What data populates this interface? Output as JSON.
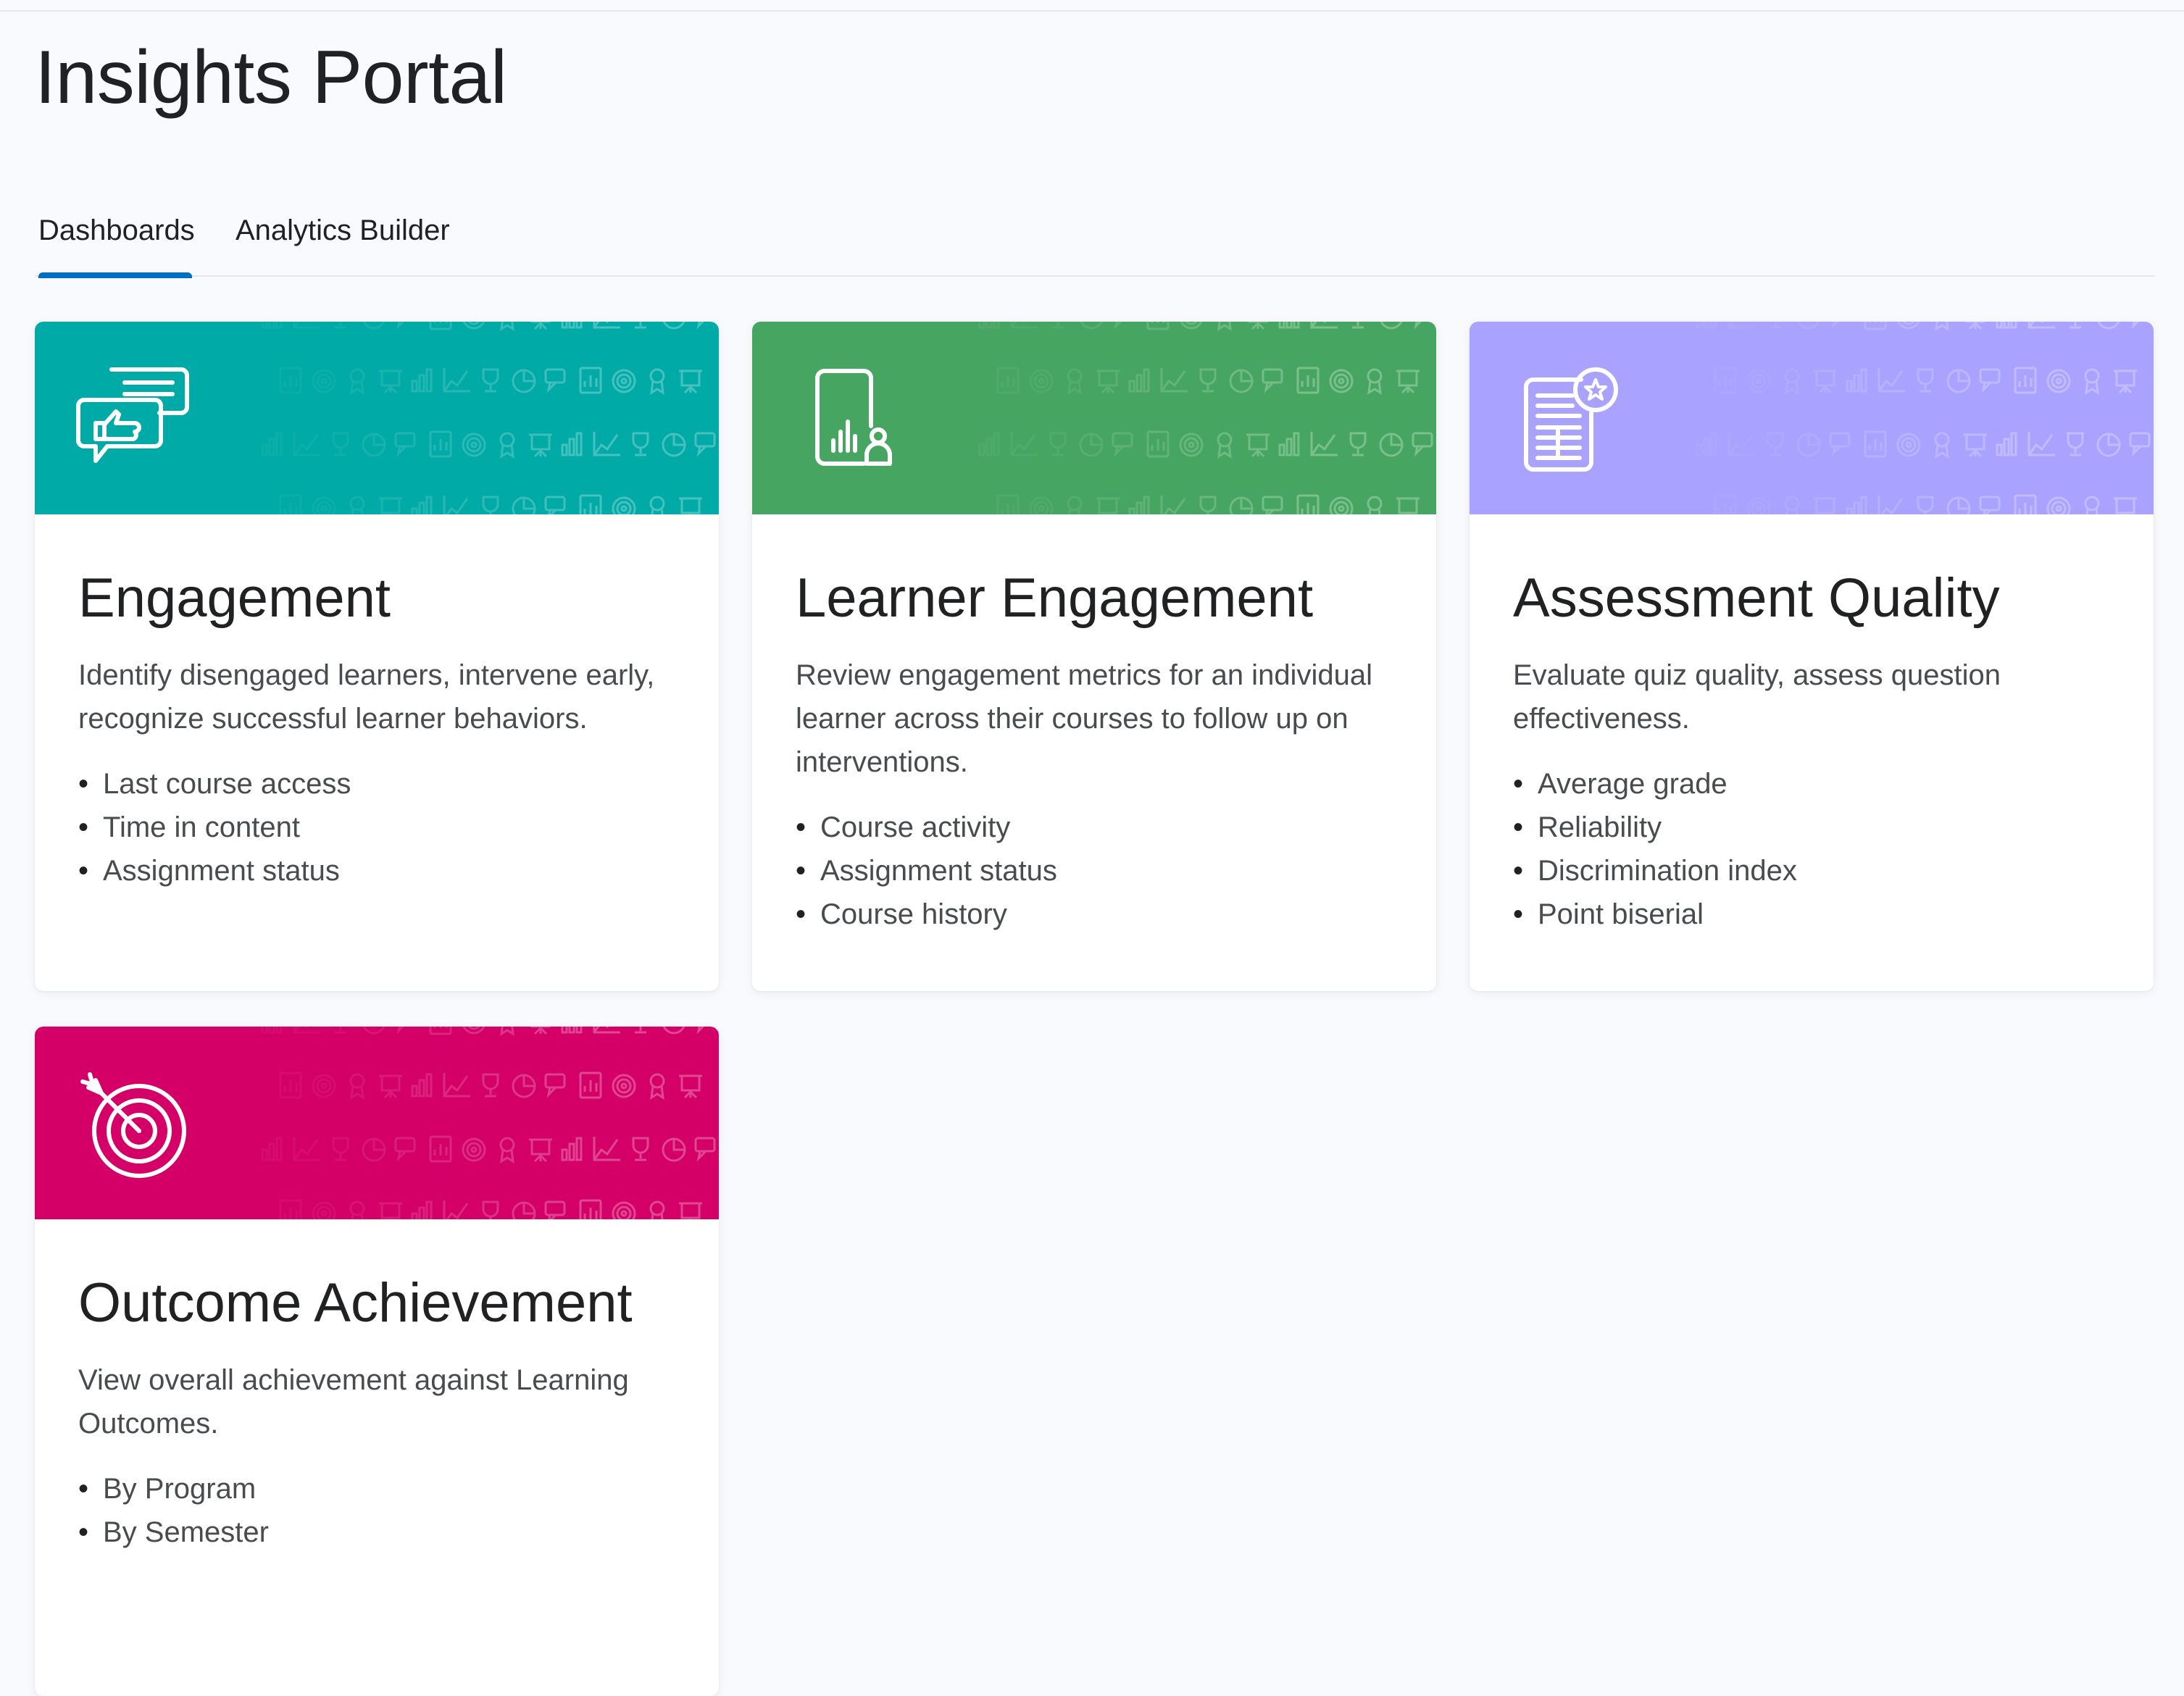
{
  "page": {
    "title": "Insights Portal"
  },
  "tabs": [
    {
      "label": "Dashboards",
      "active": true
    },
    {
      "label": "Analytics Builder",
      "active": false
    }
  ],
  "colors": {
    "tab_underline": "#006fbf",
    "engagement": "#00aaa6",
    "learner_engagement": "#46a661",
    "assessment_quality": "#a9a3ff",
    "outcome_achievement": "#d40067"
  },
  "cards": [
    {
      "title": "Engagement",
      "description": "Identify disengaged learners, intervene early, recognize successful learner behaviors.",
      "icon": "chat-thumbs-up-icon",
      "bullets": [
        "Last course access",
        "Time in content",
        "Assignment status"
      ]
    },
    {
      "title": "Learner Engagement",
      "description": "Review engagement metrics for an individual learner across their courses to follow up on interventions.",
      "icon": "tablet-chart-user-icon",
      "bullets": [
        "Course activity",
        "Assignment status",
        "Course history"
      ]
    },
    {
      "title": "Assessment Quality",
      "description": "Evaluate quiz quality, assess question effectiveness.",
      "icon": "document-star-icon",
      "bullets": [
        "Average grade",
        "Reliability",
        "Discrimination index",
        "Point biserial"
      ]
    },
    {
      "title": "Outcome Achievement",
      "description": "View overall achievement against Learning Outcomes.",
      "icon": "target-arrow-icon",
      "bullets": [
        "By Program",
        "By Semester"
      ]
    }
  ]
}
